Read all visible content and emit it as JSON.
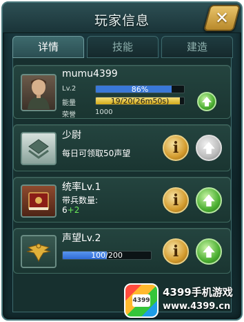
{
  "window": {
    "title": "玩家信息"
  },
  "close": {
    "label": "✕"
  },
  "tabs": [
    {
      "label": "详情",
      "active": true
    },
    {
      "label": "技能",
      "active": false
    },
    {
      "label": "建造",
      "active": false
    }
  ],
  "player": {
    "name": "mumu4399",
    "level_label": "Lv.2",
    "level_percent_text": "86%",
    "level_progress": 0.86,
    "energy_label": "能量",
    "energy_text": "19/20(26m50s)",
    "energy_progress": 0.95,
    "honor_label": "荣誉",
    "honor_value": "1000"
  },
  "rank": {
    "title": "少尉",
    "desc": "每日可领取50声望"
  },
  "leadership": {
    "title": "统率Lv.1",
    "desc_label": "带兵数量:",
    "base": "6",
    "bonus": "+2"
  },
  "prestige": {
    "title": "声望Lv.2",
    "bar_text": "100/200",
    "progress": 0.5
  },
  "info_icon_glyph": "i",
  "colors": {
    "xp_bar": "#3a78d8",
    "energy_bar": "#e9c22c",
    "prestige_bar": "#2f6bd6",
    "bonus_green": "#6bec59"
  },
  "watermark": {
    "logo_text": "4399",
    "name": "4399手机游戏",
    "url": "www.4399.cn"
  }
}
